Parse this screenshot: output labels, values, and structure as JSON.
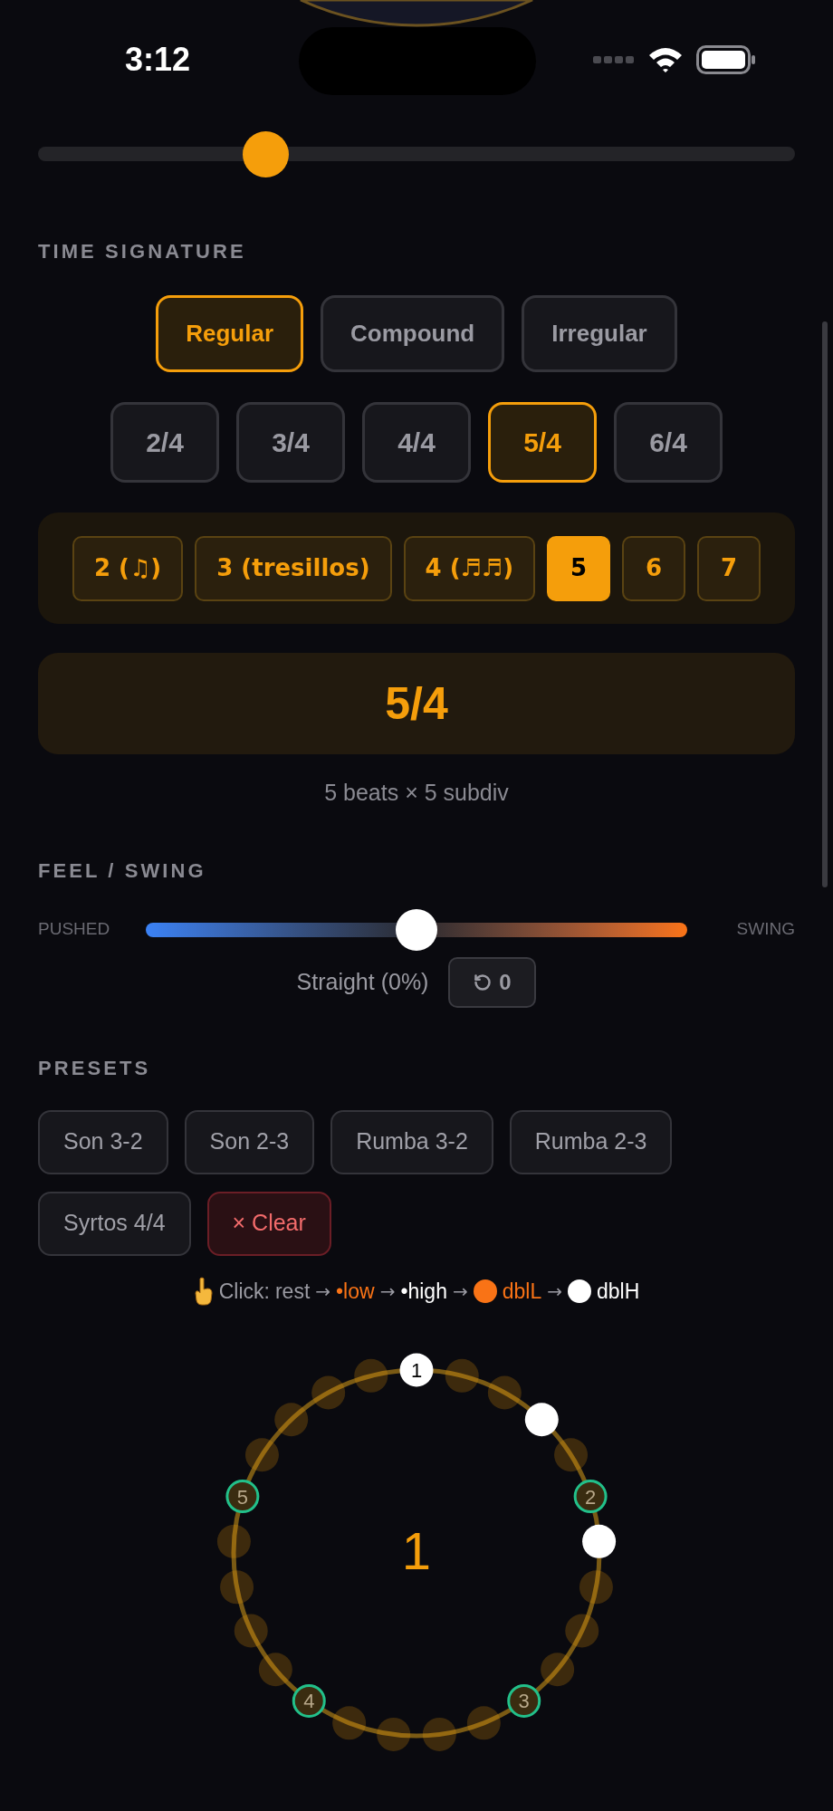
{
  "status_bar": {
    "time": "3:12"
  },
  "tempo_slider": {
    "level": 0.3
  },
  "time_signature": {
    "heading": "TIME SIGNATURE",
    "categories": [
      {
        "label": "Regular",
        "selected": true
      },
      {
        "label": "Compound",
        "selected": false
      },
      {
        "label": "Irregular",
        "selected": false
      }
    ],
    "signatures": [
      {
        "label": "2/4",
        "selected": false
      },
      {
        "label": "3/4",
        "selected": false
      },
      {
        "label": "4/4",
        "selected": false
      },
      {
        "label": "5/4",
        "selected": true
      },
      {
        "label": "6/4",
        "selected": false
      }
    ],
    "subdivisions": [
      {
        "label": "2 (♫)",
        "selected": false
      },
      {
        "label": "3 (tresillos)",
        "selected": false
      },
      {
        "label": "4 (♬♬)",
        "selected": false
      },
      {
        "label": "5",
        "selected": true
      },
      {
        "label": "6",
        "selected": false
      },
      {
        "label": "7",
        "selected": false
      }
    ],
    "display": "5/4",
    "summary": "5 beats × 5 subdiv"
  },
  "feel": {
    "heading": "FEEL / SWING",
    "left_label": "PUSHED",
    "right_label": "SWING",
    "level": 0.5,
    "reading": "Straight (0%)",
    "reset_label": "0"
  },
  "presets": {
    "heading": "PRESETS",
    "items": [
      {
        "label": "Son 3-2",
        "kind": "preset"
      },
      {
        "label": "Son 2-3",
        "kind": "preset"
      },
      {
        "label": "Rumba 3-2",
        "kind": "preset"
      },
      {
        "label": "Rumba 2-3",
        "kind": "preset"
      },
      {
        "label": "Syrtos 4/4",
        "kind": "preset"
      },
      {
        "label": "× Clear",
        "kind": "clear"
      }
    ]
  },
  "legend": {
    "prefix": "Click:",
    "items": [
      {
        "kind": "rest",
        "label": "rest"
      },
      {
        "kind": "low",
        "label": "•low",
        "arrow": "→"
      },
      {
        "kind": "high",
        "label": "•high",
        "arrow": "→"
      },
      {
        "kind": "dblL",
        "label": "dblL",
        "arrow": "→"
      },
      {
        "kind": "dblH",
        "label": "dblH",
        "arrow": "→"
      }
    ]
  },
  "beat_circle": {
    "center_label": "1",
    "steps": [
      {
        "kind": "high",
        "beat": "1"
      },
      {
        "kind": "rest"
      },
      {
        "kind": "rest"
      },
      {
        "kind": "high"
      },
      {
        "kind": "rest"
      },
      {
        "kind": "rest",
        "beat": "2"
      },
      {
        "kind": "high"
      },
      {
        "kind": "rest"
      },
      {
        "kind": "rest"
      },
      {
        "kind": "rest"
      },
      {
        "kind": "rest",
        "beat": "3"
      },
      {
        "kind": "rest"
      },
      {
        "kind": "rest"
      },
      {
        "kind": "rest"
      },
      {
        "kind": "rest"
      },
      {
        "kind": "rest",
        "beat": "4"
      },
      {
        "kind": "rest"
      },
      {
        "kind": "rest"
      },
      {
        "kind": "rest"
      },
      {
        "kind": "rest"
      },
      {
        "kind": "rest",
        "beat": "5"
      },
      {
        "kind": "rest"
      },
      {
        "kind": "rest"
      },
      {
        "kind": "rest"
      },
      {
        "kind": "rest"
      }
    ]
  }
}
